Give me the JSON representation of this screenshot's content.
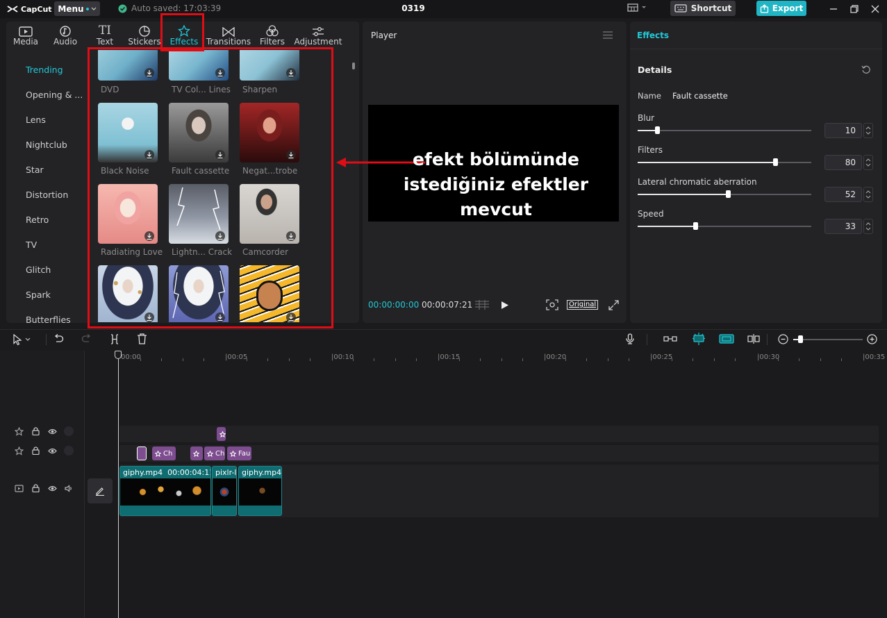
{
  "app": {
    "menu_label": "Menu",
    "autosave": "Auto saved: 17:03:39",
    "project_title": "0319",
    "shortcut_label": "Shortcut",
    "export_label": "Export"
  },
  "toolbar_tabs": [
    {
      "label": "Media",
      "icon": "media-icon"
    },
    {
      "label": "Audio",
      "icon": "audio-icon"
    },
    {
      "label": "Text",
      "icon": "text-icon"
    },
    {
      "label": "Stickers",
      "icon": "stickers-icon"
    },
    {
      "label": "Effects",
      "icon": "effects-icon",
      "active": true
    },
    {
      "label": "Transitions",
      "icon": "transitions-icon"
    },
    {
      "label": "Filters",
      "icon": "filters-icon"
    },
    {
      "label": "Adjustment",
      "icon": "adjustment-icon"
    }
  ],
  "categories": [
    "Trending",
    "Opening & ...",
    "Lens",
    "Nightclub",
    "Star",
    "Distortion",
    "Retro",
    "TV",
    "Glitch",
    "Spark",
    "Butterflies"
  ],
  "effects": [
    {
      "label": "DVD"
    },
    {
      "label": "TV Col... Lines"
    },
    {
      "label": "Sharpen"
    },
    {
      "label": "Black Noise"
    },
    {
      "label": "Fault cassette"
    },
    {
      "label": "Negat...trobe"
    },
    {
      "label": "Radiating Love"
    },
    {
      "label": "Lightn... Crack"
    },
    {
      "label": "Camcorder"
    },
    {
      "label": ""
    },
    {
      "label": ""
    },
    {
      "label": ""
    }
  ],
  "player": {
    "title": "Player",
    "annotation_line1": "efekt bölümünde",
    "annotation_line2": "istediğiniz efektler mevcut",
    "time_current": "00:00:00:00",
    "time_total": "00:00:07:21",
    "original_label": "Original"
  },
  "effects_panel": {
    "tab_label": "Effects",
    "details_title": "Details",
    "name_label": "Name",
    "name_value": "Fault cassette",
    "params": [
      {
        "label": "Blur",
        "value": "10",
        "fraction": 0.11
      },
      {
        "label": "Filters",
        "value": "80",
        "fraction": 0.79
      },
      {
        "label": "Lateral chromatic aberration",
        "value": "52",
        "fraction": 0.52
      },
      {
        "label": "Speed",
        "value": "33",
        "fraction": 0.33
      }
    ]
  },
  "timeline": {
    "ruler": [
      "00:00",
      "|00:05",
      "|00:10",
      "|00:15",
      "|00:20",
      "|00:25",
      "|00:30",
      "|00:35"
    ],
    "fx_clips": [
      {
        "label": ""
      },
      {
        "label": "Ch"
      },
      {
        "label": ""
      },
      {
        "label": "Ch"
      },
      {
        "label": "Fau"
      }
    ],
    "video_clips": [
      {
        "name": "giphy.mp4",
        "duration": "00:00:04:11"
      },
      {
        "name": "pixlr-l",
        "duration": ""
      },
      {
        "name": "giphy.mp4",
        "duration": ""
      }
    ],
    "zoom_fraction": 0.1
  },
  "colors": {
    "accent": "#22c8d6",
    "annotation_red": "#e00d15",
    "fx_clip": "#7d4d8f",
    "video_clip": "#0f6c70"
  }
}
